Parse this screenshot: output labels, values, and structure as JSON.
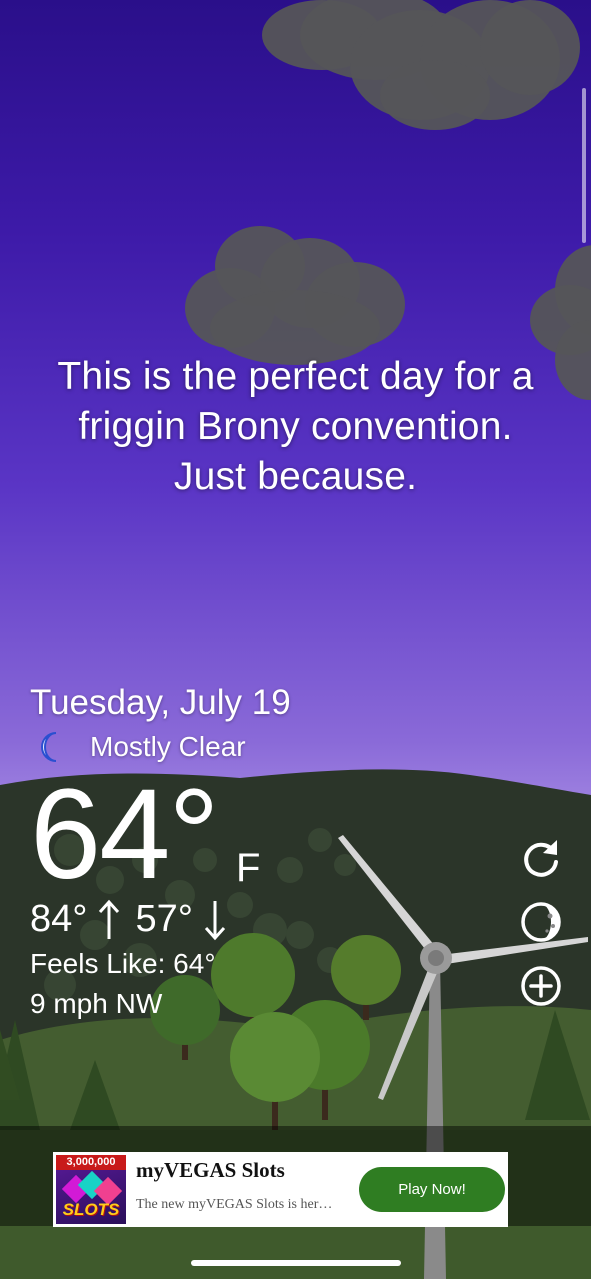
{
  "slogan": {
    "line1": "This is the perfect day for a",
    "line2": "friggin Brony convention.",
    "line3": "Just because."
  },
  "weather": {
    "date": "Tuesday, July 19",
    "condition": "Mostly Clear",
    "condition_icon": "crescent-moon-icon",
    "temperature": "64°",
    "unit": "F",
    "high": "84°",
    "low": "57°",
    "feels_like": "Feels Like: 64°",
    "wind": "9 mph NW"
  },
  "controls": [
    "refresh-icon",
    "moon-phase-icon",
    "add-location-icon"
  ],
  "ad": {
    "badge": "3,000,000",
    "icon_text": "SLOTS",
    "title": "myVEGAS Slots",
    "description": "The new myVEGAS Slots is her…",
    "button": "Play Now!",
    "button_color": "#2f7d22"
  },
  "colors": {
    "sky_top": "#2a0f8a",
    "sky_bottom": "#c6b2f0",
    "hill": "#2d3a2c",
    "grass": "#4a6a34"
  }
}
